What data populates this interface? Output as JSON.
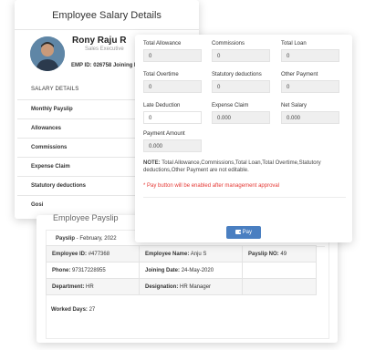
{
  "salary_details": {
    "title": "Employee Salary Details",
    "employee_name": "Rony Raju R",
    "employee_role": "Sales Executive",
    "emp_id_label": "EMP ID:",
    "emp_id_value": "026758",
    "joining_label": "Joining Da",
    "section_header": "SALARY DETAILS",
    "rows": [
      "Monthly Payslip",
      "Allowances",
      "Commissions",
      "Expense Claim",
      "Statutory deductions",
      "Gosi"
    ]
  },
  "form": {
    "fields": [
      {
        "label": "Total Allowance",
        "value": "0"
      },
      {
        "label": "Commissions",
        "value": "0"
      },
      {
        "label": "Total Loan",
        "value": "0"
      },
      {
        "label": "Total Overtime",
        "value": "0"
      },
      {
        "label": "Statutory deductions",
        "value": "0"
      },
      {
        "label": "Other Payment",
        "value": "0"
      },
      {
        "label": "Late Deduction",
        "value": "0"
      },
      {
        "label": "Expense Claim",
        "value": "0.000"
      },
      {
        "label": "Net Salary",
        "value": "0.000"
      },
      {
        "label": "Payment Amount",
        "value": "0.000"
      }
    ],
    "note_label": "NOTE:",
    "note_text": "Total Allowance,Commissions,Total Loan,Total Overtime,Statutory deductions,Other Payment are not editable.",
    "warning": "* Pay button will be enabled after management approval",
    "pay_button_label": "Pay",
    "pay_icon": "wallet-icon"
  },
  "payslip": {
    "title": "Employee Payslip",
    "header_label": "Payslip",
    "header_period": "February, 2022",
    "download_icon": "download-icon",
    "table": [
      [
        {
          "label": "Employee ID:",
          "value": "#477368"
        },
        {
          "label": "Employee Name:",
          "value": "Anju S"
        },
        {
          "label": "Payslip NO:",
          "value": "49"
        }
      ],
      [
        {
          "label": "Phone:",
          "value": "97317228955"
        },
        {
          "label": "Joining Date:",
          "value": "24-May-2020"
        },
        {
          "label": "",
          "value": ""
        }
      ],
      [
        {
          "label": "Department:",
          "value": "HR"
        },
        {
          "label": "Designation:",
          "value": "HR Manager"
        },
        {
          "label": "",
          "value": ""
        }
      ]
    ],
    "worked_days_label": "Worked Days:",
    "worked_days_value": "27"
  }
}
